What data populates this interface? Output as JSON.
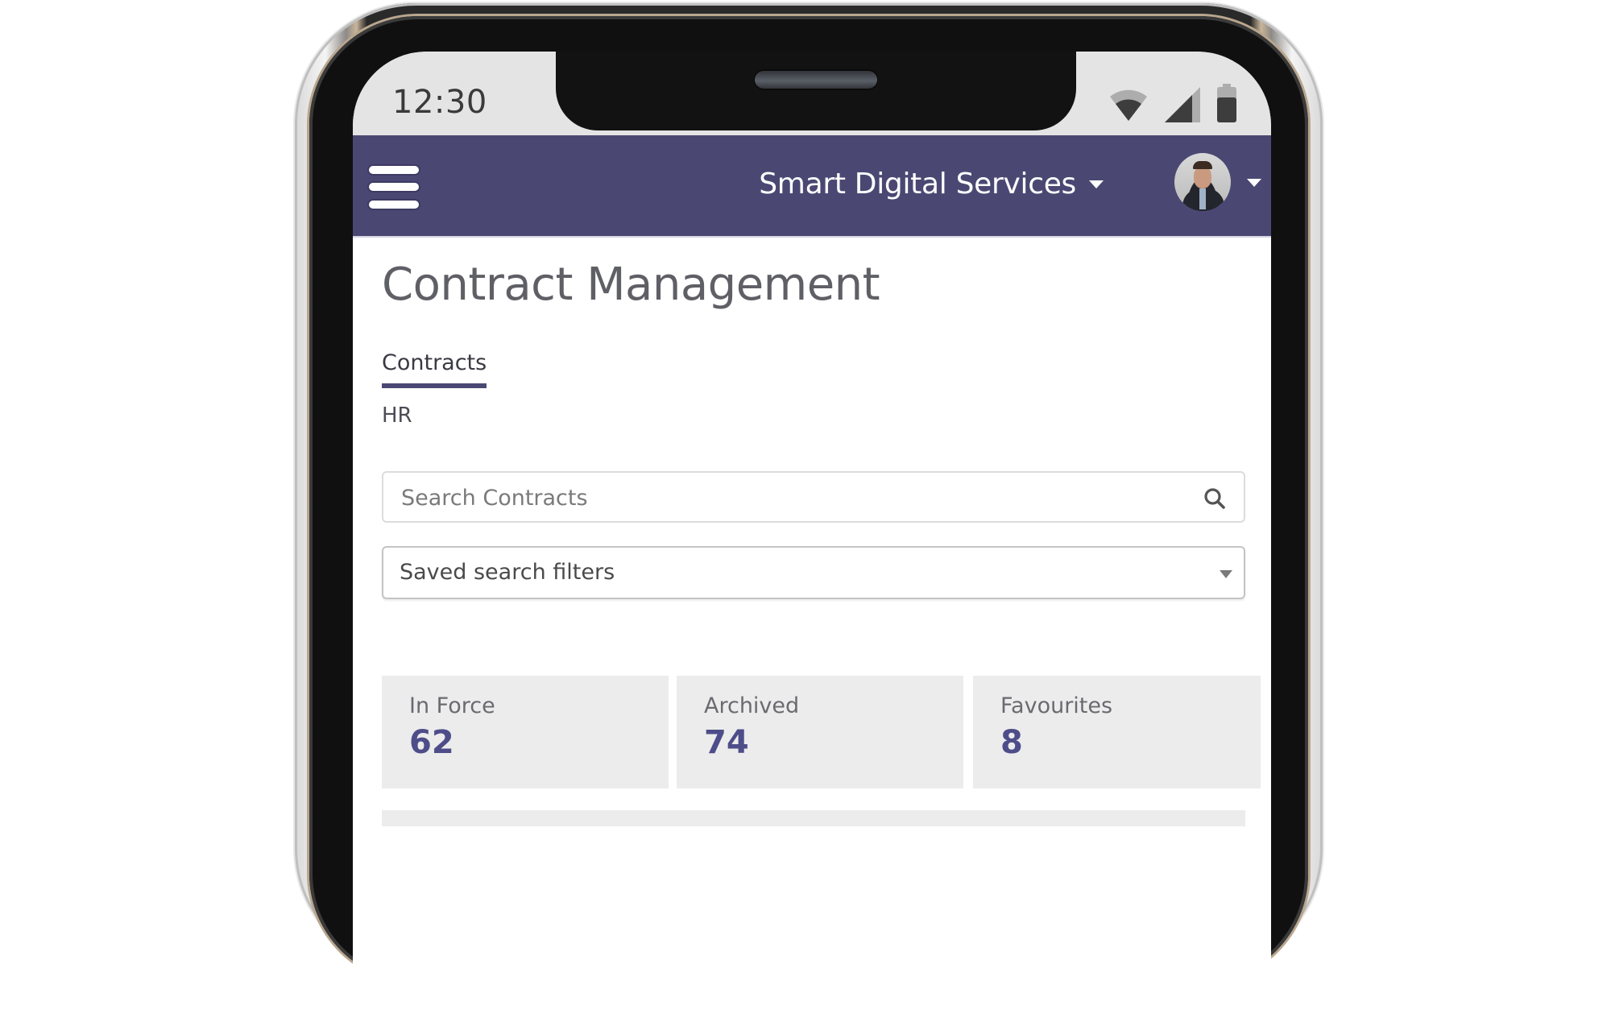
{
  "status_bar": {
    "time": "12:30",
    "icons": [
      "wifi-icon",
      "cellular-signal-icon",
      "battery-icon"
    ]
  },
  "header": {
    "menu_icon": "hamburger-menu-icon",
    "organization": "Smart Digital Services",
    "org_dropdown_icon": "caret-down-icon",
    "avatar_icon": "user-avatar",
    "avatar_dropdown_icon": "caret-down-icon",
    "colors": {
      "brand": "#4a4873",
      "text": "#ffffff"
    }
  },
  "main": {
    "page_title": "Contract Management",
    "tabs": [
      {
        "label": "Contracts",
        "active": true
      }
    ],
    "sub_label": "HR",
    "search": {
      "placeholder": "Search Contracts",
      "value": "",
      "icon": "search-icon"
    },
    "saved_filters": {
      "selected": "Saved search filters",
      "icon": "caret-down-icon"
    },
    "stats": [
      {
        "label": "In Force",
        "value": "62"
      },
      {
        "label": "Archived",
        "value": "74"
      },
      {
        "label": "Favourites",
        "value": "8"
      }
    ],
    "colors": {
      "title": "#5f5f66",
      "stat_value": "#4e4d8a",
      "card_bg": "#ececec"
    }
  }
}
